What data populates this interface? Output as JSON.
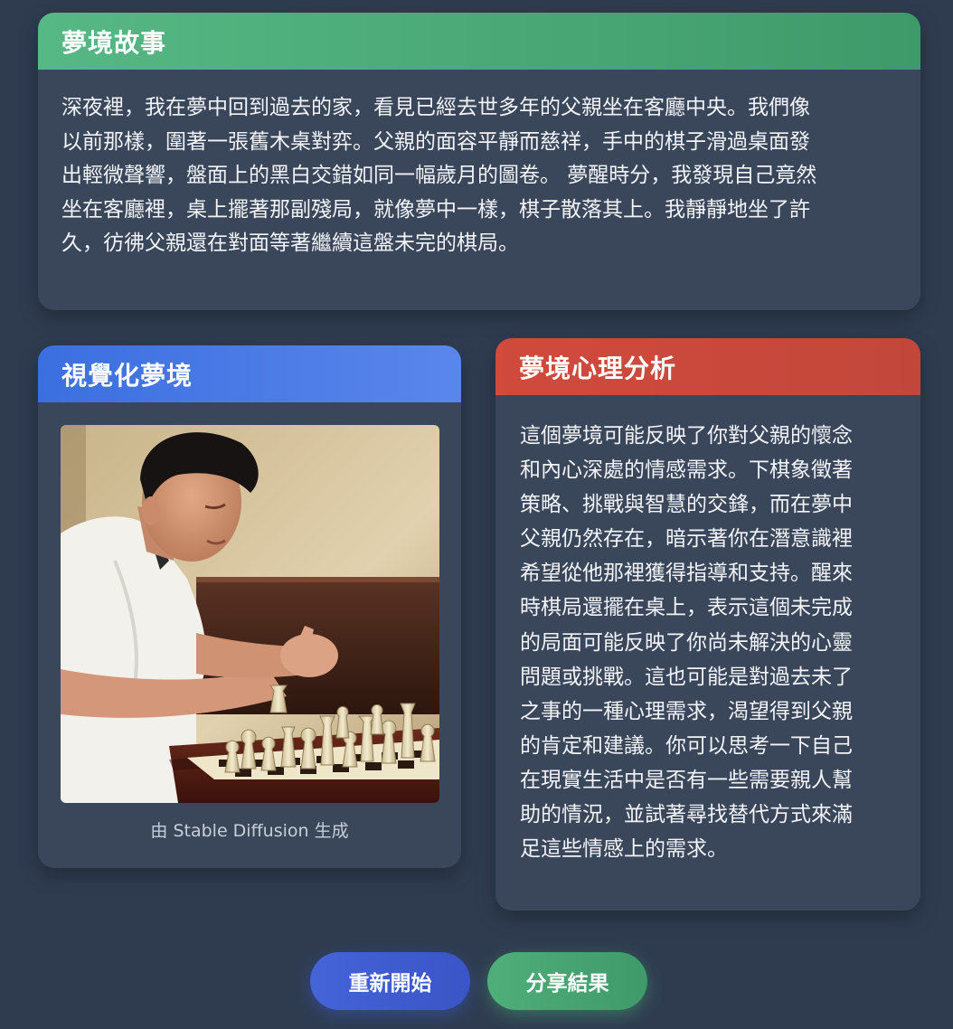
{
  "story": {
    "title": "夢境故事",
    "lines": [
      "深夜裡，我在夢中回到過去的家，看見已經去世多年的父親坐在客廳中央。我們像",
      "以前那樣，圍著一張舊木桌對弈。父親的面容平靜而慈祥，手中的棋子滑過桌面發",
      "出輕微聲響，盤面上的黑白交錯如同一幅歲月的圖卷。 夢醒時分，我發現自己竟然",
      "坐在客廳裡，桌上擺著那副殘局，就像夢中一樣，棋子散落其上。我靜靜地坐了許",
      "久，彷彿父親還在對面等著繼續這盤未完的棋局。"
    ]
  },
  "visual": {
    "title": "視覺化夢境",
    "caption": "由 Stable Diffusion 生成"
  },
  "analysis": {
    "title": "夢境心理分析",
    "lines": [
      "這個夢境可能反映了你對父親的懷念",
      "和內心深處的情感需求。下棋象徵著",
      "策略、挑戰與智慧的交鋒，而在夢中",
      "父親仍然存在，暗示著你在潛意識裡",
      "希望從他那裡獲得指導和支持。醒來",
      "時棋局還擺在桌上，表示這個未完成",
      "的局面可能反映了你尚未解決的心靈",
      "問題或挑戰。這也可能是對過去未了",
      "之事的一種心理需求，渴望得到父親",
      "的肯定和建議。你可以思考一下自己",
      "在現實生活中是否有一些需要親人幫",
      "助的情況，並試著尋找替代方式來滿",
      "足這些情感上的需求。"
    ]
  },
  "actions": {
    "restart_label": "重新開始",
    "share_label": "分享結果"
  },
  "colors": {
    "background": "#2f3c50",
    "card": "#3a475b",
    "story_header": "#4fae7a",
    "visual_header": "#4a78e6",
    "analysis_header": "#c8493c"
  }
}
